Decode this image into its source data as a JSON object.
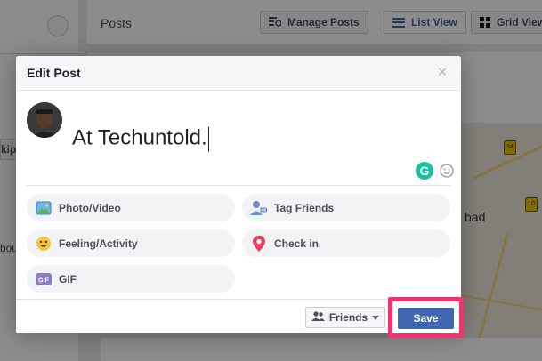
{
  "background": {
    "posts_title": "Posts",
    "manage_posts_label": "Manage Posts",
    "list_view_label": "List View",
    "grid_view_label": "Grid View",
    "skip_label": "kip",
    "left_text": "bou",
    "map_label": "bad",
    "map_pins": [
      "34",
      "10"
    ]
  },
  "modal": {
    "title": "Edit Post",
    "close_symbol": "×",
    "post_text": "At Techuntold.",
    "grammarly_letter": "G",
    "actions": [
      {
        "label": "Photo/Video",
        "icon": "photo-video-icon"
      },
      {
        "label": "Tag Friends",
        "icon": "tag-friends-icon"
      },
      {
        "label": "Feeling/Activity",
        "icon": "feeling-icon"
      },
      {
        "label": "Check in",
        "icon": "location-pin-icon"
      },
      {
        "label": "GIF",
        "icon": "gif-icon"
      }
    ],
    "footer": {
      "audience_label": "Friends",
      "save_label": "Save"
    }
  },
  "colors": {
    "accent": "#4267b2",
    "highlight": "#f5326c",
    "grammarly": "#15c39a"
  }
}
